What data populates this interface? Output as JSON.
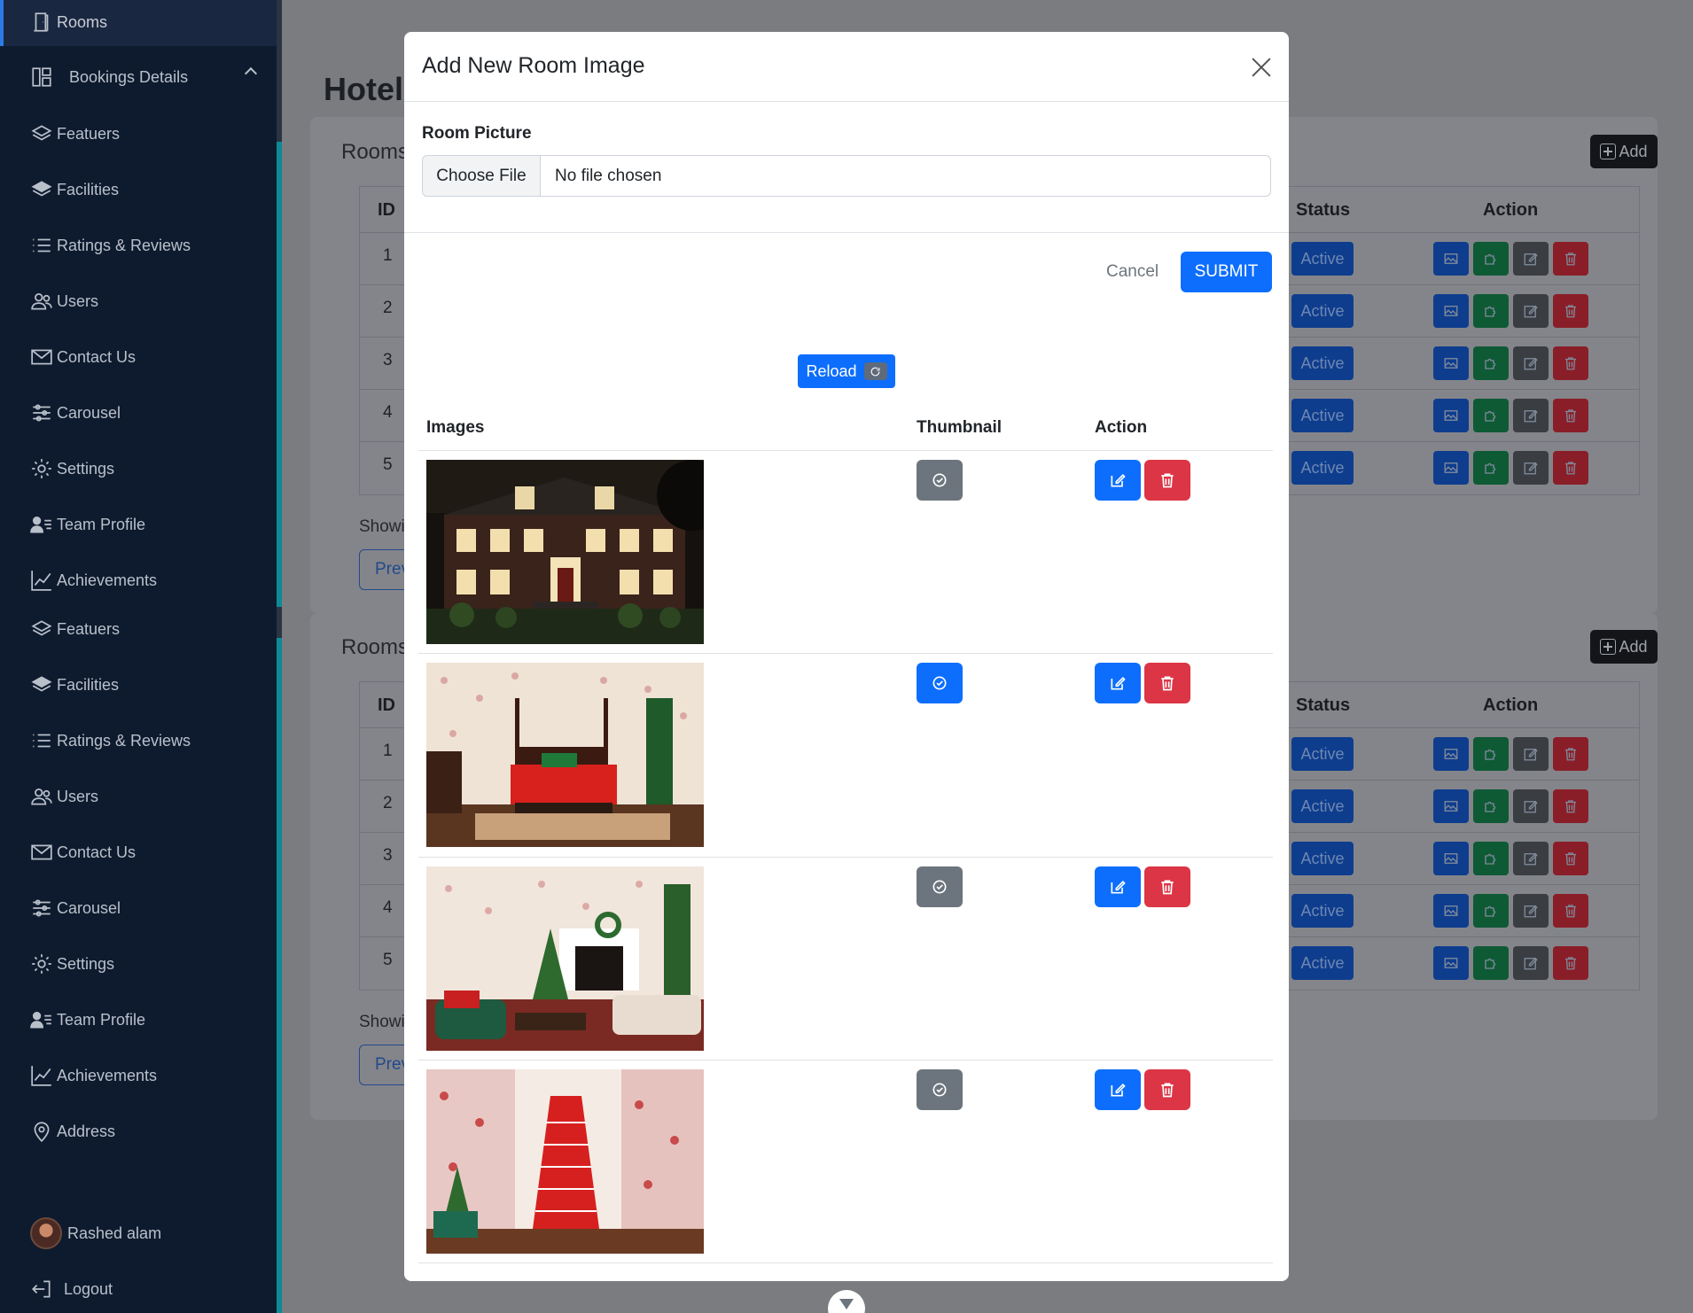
{
  "sidebar": {
    "items": [
      {
        "label": "Rooms",
        "icon": "door-icon"
      },
      {
        "label": "Bookings Details",
        "icon": "layout-icon"
      },
      {
        "label": "Featuers",
        "icon": "layers-icon"
      },
      {
        "label": "Facilities",
        "icon": "layers-filled-icon"
      },
      {
        "label": "Ratings & Reviews",
        "icon": "list-icon"
      },
      {
        "label": "Users",
        "icon": "users-icon"
      },
      {
        "label": "Contact Us",
        "icon": "envelope-icon"
      },
      {
        "label": "Carousel",
        "icon": "sliders-icon"
      },
      {
        "label": "Settings",
        "icon": "gear-icon"
      },
      {
        "label": "Team Profile",
        "icon": "person-lines-icon"
      },
      {
        "label": "Achievements",
        "icon": "graph-up-icon"
      },
      {
        "label": "Featuers",
        "icon": "layers-icon"
      },
      {
        "label": "Facilities",
        "icon": "layers-filled-icon"
      },
      {
        "label": "Ratings & Reviews",
        "icon": "list-icon"
      },
      {
        "label": "Users",
        "icon": "users-icon"
      },
      {
        "label": "Contact Us",
        "icon": "envelope-icon"
      },
      {
        "label": "Carousel",
        "icon": "sliders-icon"
      },
      {
        "label": "Settings",
        "icon": "gear-icon"
      },
      {
        "label": "Team Profile",
        "icon": "person-lines-icon"
      },
      {
        "label": "Achievements",
        "icon": "graph-up-icon"
      },
      {
        "label": "Address",
        "icon": "geo-pin-icon"
      }
    ],
    "user": {
      "name": "Rashed alam"
    },
    "logout": "Logout"
  },
  "main": {
    "title": "Hotel",
    "cards": [
      {
        "title": "Rooms",
        "add_label": "Add",
        "showing": "Showi",
        "prev": "Prev"
      },
      {
        "title": "Rooms",
        "add_label": "Add",
        "showing": "Showi",
        "prev": "Prev"
      }
    ],
    "table": {
      "headers": {
        "id": "ID",
        "status": "Status",
        "action": "Action"
      },
      "ids": [
        "1",
        "2",
        "3",
        "4",
        "5"
      ],
      "status": "Active"
    }
  },
  "modal": {
    "title": "Add New Room Image",
    "field_label": "Room Picture",
    "file_button": "Choose File",
    "file_text": "No file chosen",
    "cancel": "Cancel",
    "submit": "SUBMIT",
    "reload": "Reload",
    "table": {
      "headers": {
        "images": "Images",
        "thumbnail": "Thumbnail",
        "action": "Action"
      },
      "rows": [
        {
          "image": "house-exterior-night",
          "is_thumbnail": false
        },
        {
          "image": "bedroom-red-bed",
          "is_thumbnail": true
        },
        {
          "image": "living-room-christmas",
          "is_thumbnail": false
        },
        {
          "image": "staircase-red-carpet",
          "is_thumbnail": false
        }
      ]
    }
  },
  "colors": {
    "sidebar_bg": "#0e1b2e",
    "primary": "#0d6efd",
    "danger": "#dc3545",
    "secondary": "#6c757d",
    "overlay": "#7b7c80"
  }
}
